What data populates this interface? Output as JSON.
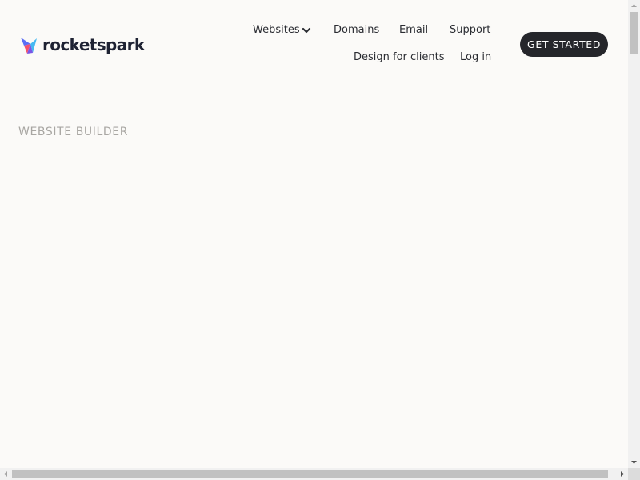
{
  "brand": {
    "name": "rocketspark",
    "logo_icon": "rocketspark-logo-icon",
    "colors": {
      "text": "#1e2233",
      "mark_primary": "#5b6ef5",
      "mark_secondary": "#45b9f2",
      "mark_accent": "#f4516b"
    }
  },
  "nav": {
    "row1": [
      {
        "id": "websites",
        "label": "Websites",
        "has_dropdown": true
      },
      {
        "id": "domains",
        "label": "Domains"
      },
      {
        "id": "email",
        "label": "Email"
      },
      {
        "id": "support",
        "label": "Support"
      }
    ],
    "row2": [
      {
        "id": "design",
        "label": "Design for clients"
      },
      {
        "id": "login",
        "label": "Log in"
      }
    ],
    "dropdown_icon": "chevron-down-icon"
  },
  "cta": {
    "label": "GET STARTED",
    "background": "#25262b",
    "color": "#ffffff"
  },
  "hero": {
    "eyebrow": "WEBSITE BUILDER"
  },
  "theme": {
    "page_background": "#fbfaf8",
    "muted_text": "#a9a7a3"
  }
}
